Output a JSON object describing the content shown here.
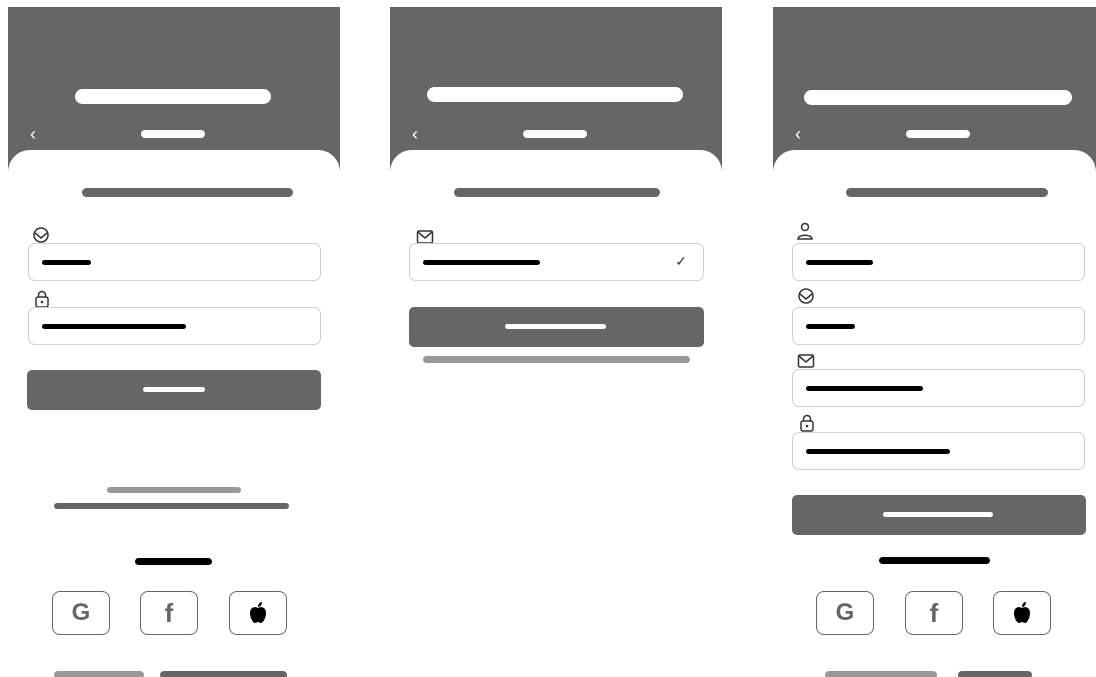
{
  "screens": [
    {
      "id": "login",
      "back_icon": "chevron-left-icon",
      "title_text": "",
      "subtitle_text": "",
      "field_icons": [
        "profile-icon",
        "lock-icon"
      ],
      "social": {
        "google_label": "G",
        "facebook_label": "f",
        "apple_icon": "apple-icon"
      }
    },
    {
      "id": "forgot-password",
      "back_icon": "chevron-left-icon",
      "field_icons": [
        "mail-icon"
      ],
      "email_status_icon": "checkmark-icon",
      "check_glyph": "✓"
    },
    {
      "id": "signup",
      "back_icon": "chevron-left-icon",
      "field_icons": [
        "user-icon",
        "profile-icon",
        "mail-icon",
        "lock-icon"
      ],
      "social": {
        "google_label": "G",
        "facebook_label": "f",
        "apple_icon": "apple-icon"
      }
    }
  ],
  "colors": {
    "header": "#666666",
    "button": "#666666",
    "field_border": "#cfcfcf",
    "placeholder_text": "#000000",
    "secondary_bar": "#999999"
  }
}
